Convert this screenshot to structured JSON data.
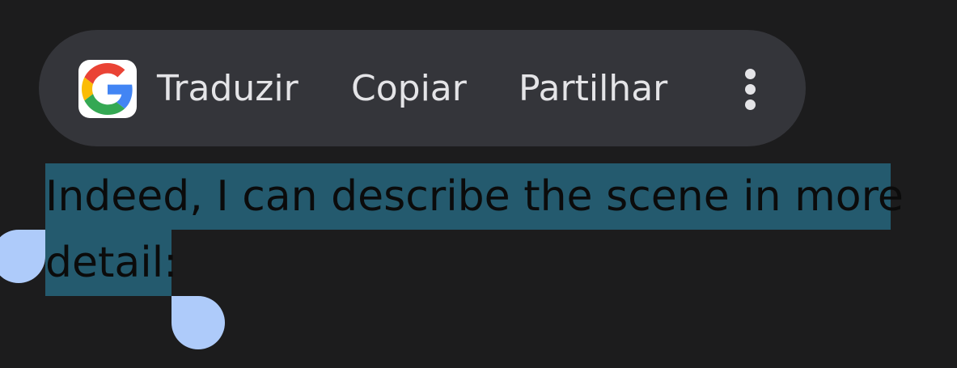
{
  "toolbar": {
    "logo_icon": "google-g-icon",
    "translate_label": "Traduzir",
    "copy_label": "Copiar",
    "share_label": "Partilhar",
    "more_icon": "more-vertical-icon"
  },
  "selection": {
    "line1": "Indeed, I can describe the scene in more",
    "line2": "detail:",
    "highlight_color": "#245a6e",
    "handle_color": "#aecbfa"
  },
  "colors": {
    "background": "#1c1c1d",
    "toolbar_background": "#34353a",
    "toolbar_text": "#e4e4e7"
  }
}
